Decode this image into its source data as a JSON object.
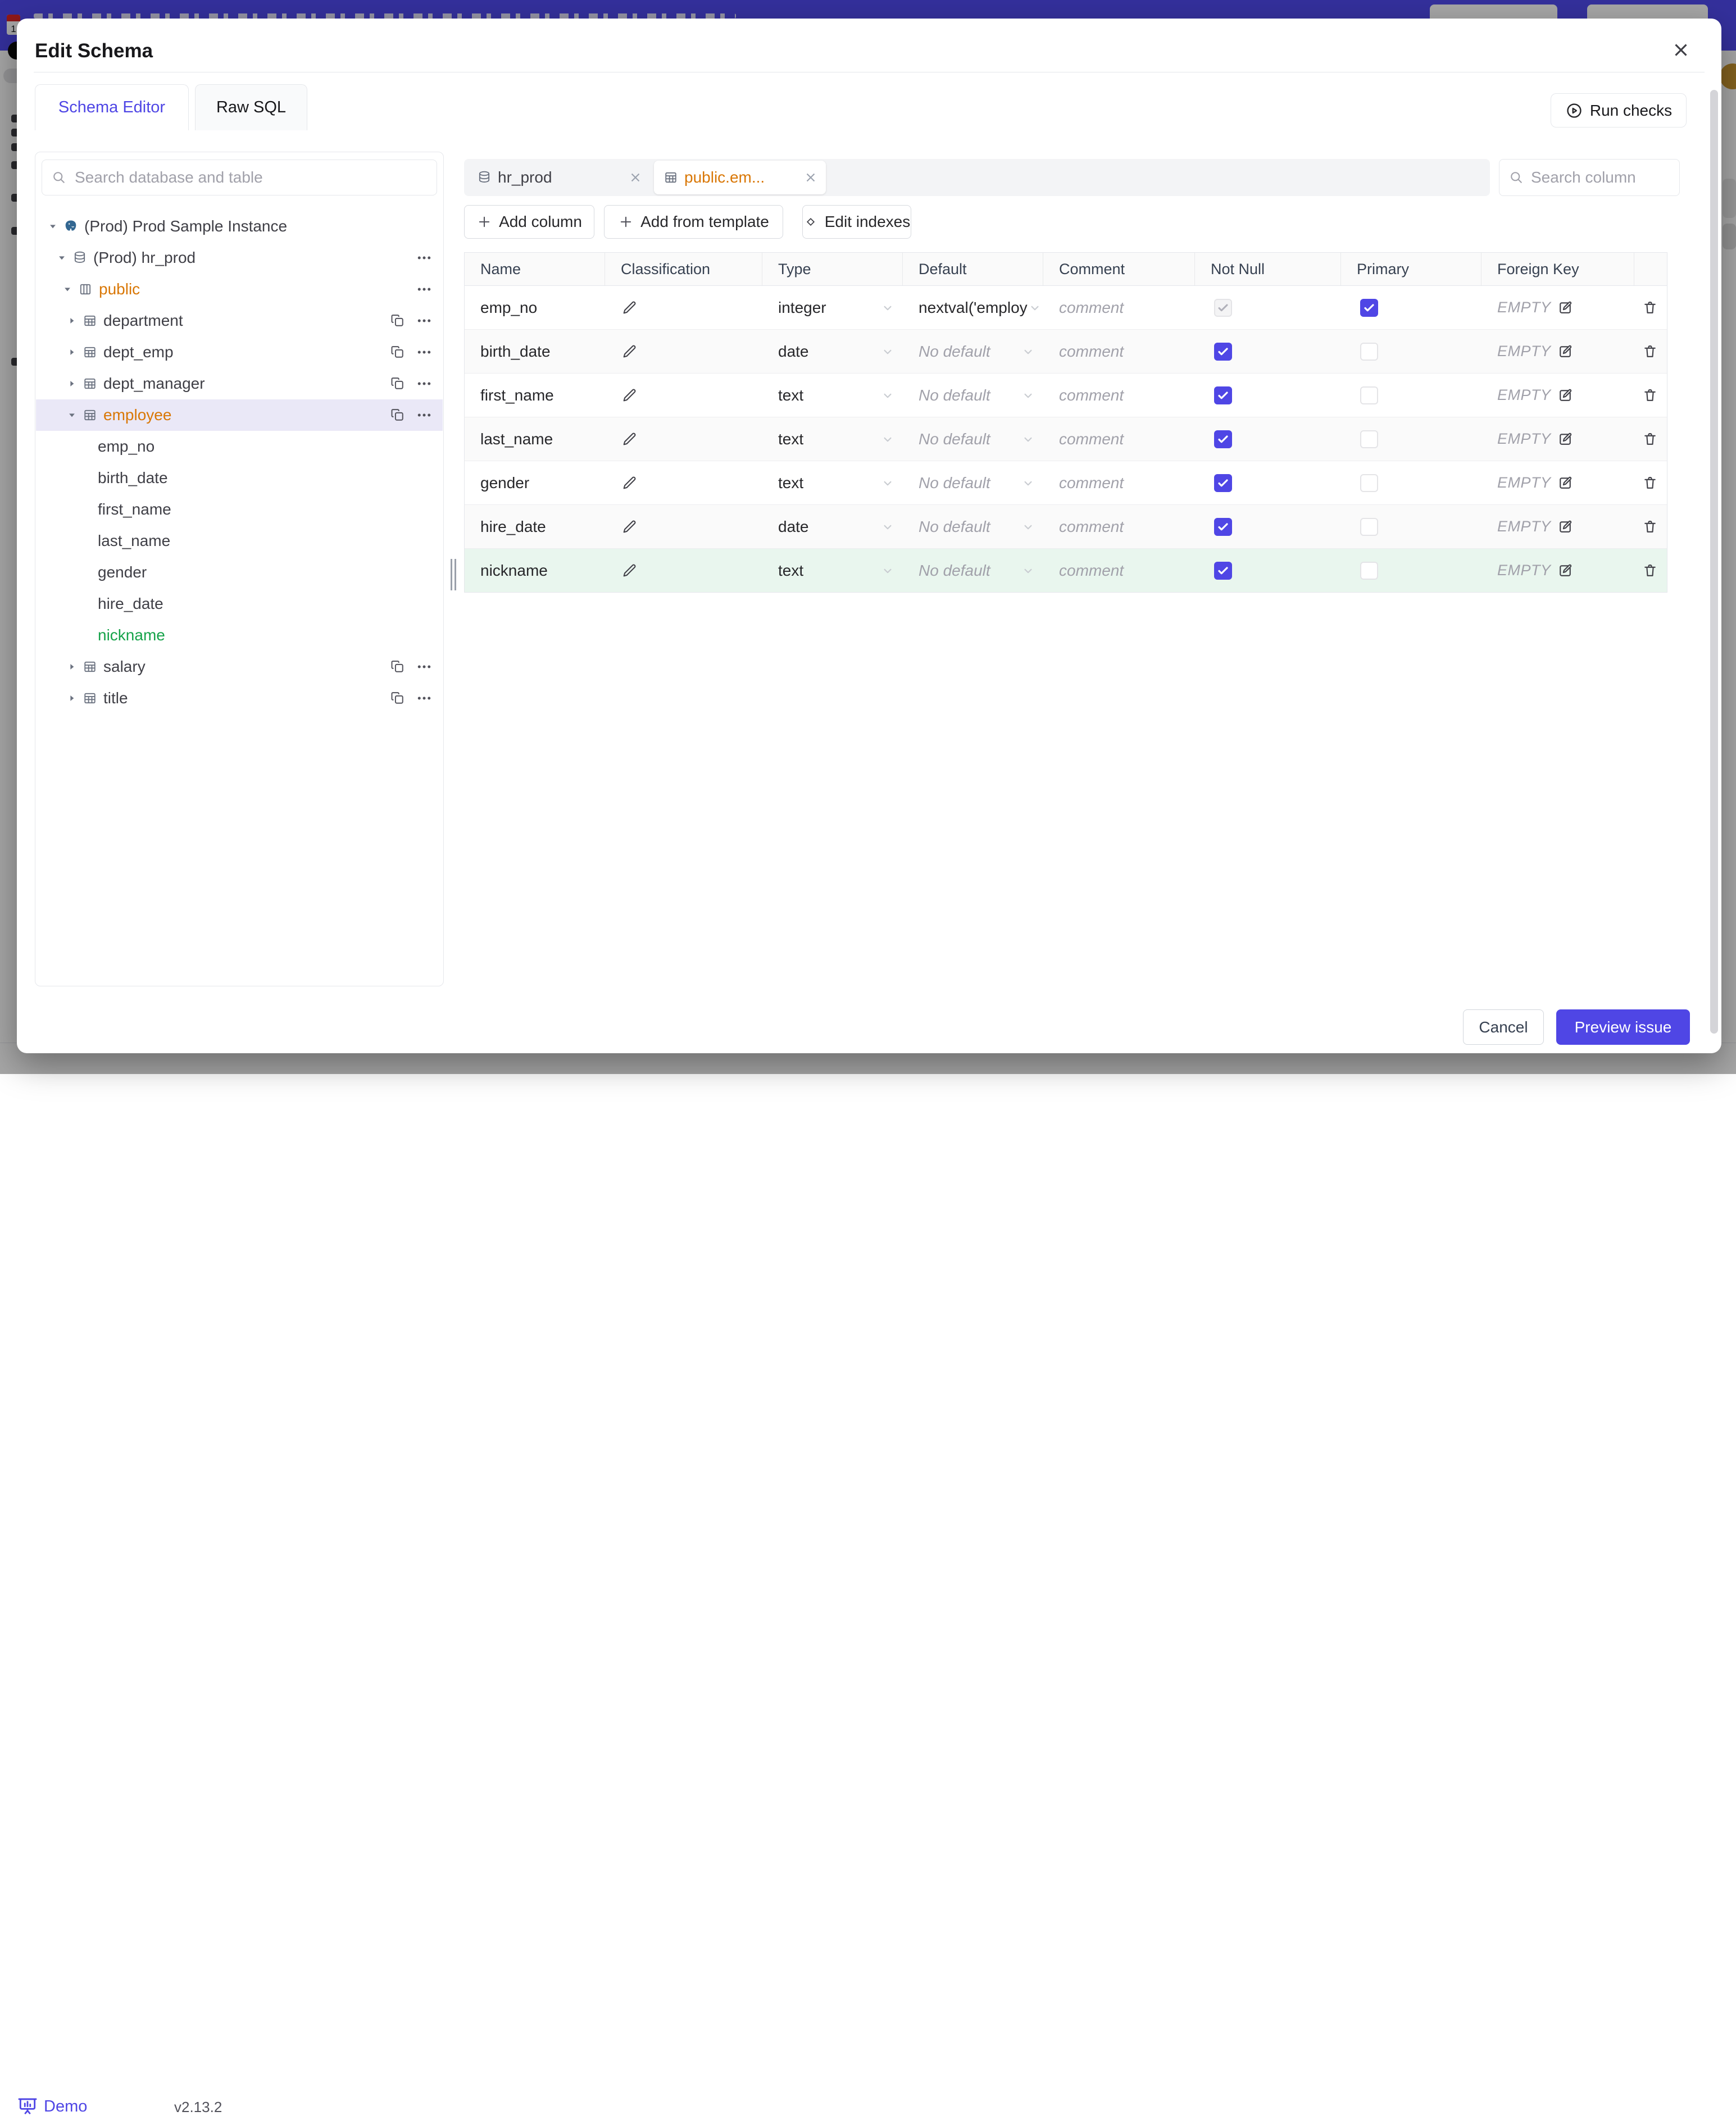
{
  "modal": {
    "title": "Edit Schema",
    "close_icon": "close-icon"
  },
  "tabs": [
    {
      "label": "Schema Editor",
      "active": true
    },
    {
      "label": "Raw SQL",
      "active": false
    }
  ],
  "run_checks": {
    "label": "Run checks",
    "icon": "play-circle-icon"
  },
  "sidebar": {
    "search_placeholder": "Search database and table",
    "tree": [
      {
        "label": "(Prod) Prod Sample Instance",
        "icon": "postgres",
        "caret": "down",
        "level": 0,
        "color": "default",
        "copy": false,
        "more": false,
        "selected": false
      },
      {
        "label": "(Prod) hr_prod",
        "icon": "database",
        "caret": "down",
        "level": 1,
        "color": "default",
        "copy": false,
        "more": true,
        "selected": false
      },
      {
        "label": "public",
        "icon": "schema",
        "caret": "down",
        "level": 2,
        "color": "orange",
        "copy": false,
        "more": true,
        "selected": false
      },
      {
        "label": "department",
        "icon": "table",
        "caret": "right",
        "level": 3,
        "color": "default",
        "copy": true,
        "more": true,
        "selected": false
      },
      {
        "label": "dept_emp",
        "icon": "table",
        "caret": "right",
        "level": 3,
        "color": "default",
        "copy": true,
        "more": true,
        "selected": false
      },
      {
        "label": "dept_manager",
        "icon": "table",
        "caret": "right",
        "level": 3,
        "color": "default",
        "copy": true,
        "more": true,
        "selected": false
      },
      {
        "label": "employee",
        "icon": "table",
        "caret": "down",
        "level": 3,
        "color": "orange",
        "copy": true,
        "more": true,
        "selected": true
      },
      {
        "label": "emp_no",
        "icon": null,
        "caret": null,
        "level": 4,
        "color": "default",
        "copy": false,
        "more": false,
        "selected": false
      },
      {
        "label": "birth_date",
        "icon": null,
        "caret": null,
        "level": 4,
        "color": "default",
        "copy": false,
        "more": false,
        "selected": false
      },
      {
        "label": "first_name",
        "icon": null,
        "caret": null,
        "level": 4,
        "color": "default",
        "copy": false,
        "more": false,
        "selected": false
      },
      {
        "label": "last_name",
        "icon": null,
        "caret": null,
        "level": 4,
        "color": "default",
        "copy": false,
        "more": false,
        "selected": false
      },
      {
        "label": "gender",
        "icon": null,
        "caret": null,
        "level": 4,
        "color": "default",
        "copy": false,
        "more": false,
        "selected": false
      },
      {
        "label": "hire_date",
        "icon": null,
        "caret": null,
        "level": 4,
        "color": "default",
        "copy": false,
        "more": false,
        "selected": false
      },
      {
        "label": "nickname",
        "icon": null,
        "caret": null,
        "level": 4,
        "color": "green",
        "copy": false,
        "more": false,
        "selected": false
      },
      {
        "label": "salary",
        "icon": "table",
        "caret": "right",
        "level": 3,
        "color": "default",
        "copy": true,
        "more": true,
        "selected": false
      },
      {
        "label": "title",
        "icon": "table",
        "caret": "right",
        "level": 3,
        "color": "default",
        "copy": true,
        "more": true,
        "selected": false
      }
    ]
  },
  "editor": {
    "chips": [
      {
        "label": "hr_prod",
        "icon": "database",
        "active": false
      },
      {
        "label": "public.em...",
        "icon": "table",
        "active": true
      }
    ],
    "search_placeholder": "Search column",
    "toolbar": [
      {
        "label": "Add column",
        "icon": "plus"
      },
      {
        "label": "Add from template",
        "icon": "plus"
      },
      {
        "label": "Edit indexes",
        "icon": "diamond"
      }
    ],
    "table": {
      "headers": [
        "Name",
        "Classification",
        "Type",
        "Default",
        "Comment",
        "Not Null",
        "Primary",
        "Foreign Key",
        ""
      ],
      "comment_placeholder": "comment",
      "rows": [
        {
          "name": "emp_no",
          "type": "integer",
          "default": "nextval('employ",
          "default_is_placeholder": false,
          "not_null_checked": true,
          "not_null_disabled": true,
          "primary_checked": true,
          "foreign_key": "EMPTY",
          "highlight": null
        },
        {
          "name": "birth_date",
          "type": "date",
          "default": "No default",
          "default_is_placeholder": true,
          "not_null_checked": true,
          "not_null_disabled": false,
          "primary_checked": false,
          "foreign_key": "EMPTY",
          "highlight": null
        },
        {
          "name": "first_name",
          "type": "text",
          "default": "No default",
          "default_is_placeholder": true,
          "not_null_checked": true,
          "not_null_disabled": false,
          "primary_checked": false,
          "foreign_key": "EMPTY",
          "highlight": null
        },
        {
          "name": "last_name",
          "type": "text",
          "default": "No default",
          "default_is_placeholder": true,
          "not_null_checked": true,
          "not_null_disabled": false,
          "primary_checked": false,
          "foreign_key": "EMPTY",
          "highlight": null
        },
        {
          "name": "gender",
          "type": "text",
          "default": "No default",
          "default_is_placeholder": true,
          "not_null_checked": true,
          "not_null_disabled": false,
          "primary_checked": false,
          "foreign_key": "EMPTY",
          "highlight": null
        },
        {
          "name": "hire_date",
          "type": "date",
          "default": "No default",
          "default_is_placeholder": true,
          "not_null_checked": true,
          "not_null_disabled": false,
          "primary_checked": false,
          "foreign_key": "EMPTY",
          "highlight": null
        },
        {
          "name": "nickname",
          "type": "text",
          "default": "No default",
          "default_is_placeholder": true,
          "not_null_checked": true,
          "not_null_disabled": false,
          "primary_checked": false,
          "foreign_key": "EMPTY",
          "highlight": "green"
        }
      ]
    }
  },
  "footer": {
    "cancel": "Cancel",
    "primary": "Preview issue"
  },
  "statusbar": {
    "brand": "Demo",
    "version": "v2.13.2"
  },
  "colors": {
    "accent": "#4f46e5",
    "modified": "#d97706",
    "added": "#16a34a",
    "added_row_bg": "#e9f6ee",
    "selected_bg": "#eae8f7",
    "topbar": "#504bf0"
  }
}
